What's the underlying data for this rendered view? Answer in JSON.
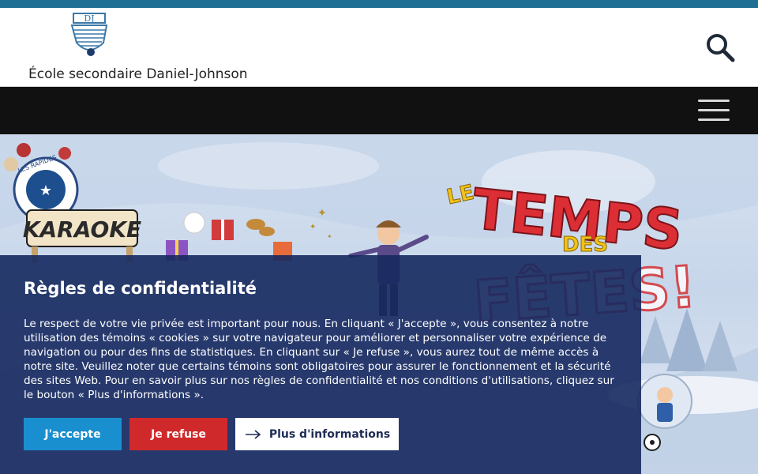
{
  "header": {
    "school_name": "École secondaire Daniel-Johnson",
    "logo_icon": "school-logo-dj-icon",
    "search_icon": "search-icon"
  },
  "navbar": {
    "menu_icon": "hamburger-menu-icon"
  },
  "hero": {
    "headline_le": "LE",
    "headline_temps": "TEMPS",
    "headline_des": "DES",
    "headline_fetes": "FÊTES!",
    "karaoke_sign": "KARAOKE",
    "badge_text": "LES RAPIDES"
  },
  "cookie_banner": {
    "title": "Règles de confidentialité",
    "body": "Le respect de votre vie privée est important pour nous. En cliquant « J'accepte », vous consentez à notre utilisation des témoins « cookies » sur votre navigateur pour améliorer et personnaliser votre expérience de navigation ou pour des fins de statistiques. En cliquant sur « Je refuse », vous aurez tout de même accès à notre site. Veuillez noter que certains témoins sont obligatoires pour assurer le fonctionnement et la sécurité des sites Web. Pour en savoir plus sur nos règles de confidentialité et nos conditions d'utilisations, cliquez sur le bouton « Plus d'informations ».",
    "accept_label": "J'accepte",
    "refuse_label": "Je refuse",
    "info_label": "Plus d'informations"
  },
  "colors": {
    "top_strip": "#1f6f95",
    "navbar": "#111111",
    "panel": "#172a60",
    "accept": "#1a8fd0",
    "refuse": "#d0292b"
  }
}
